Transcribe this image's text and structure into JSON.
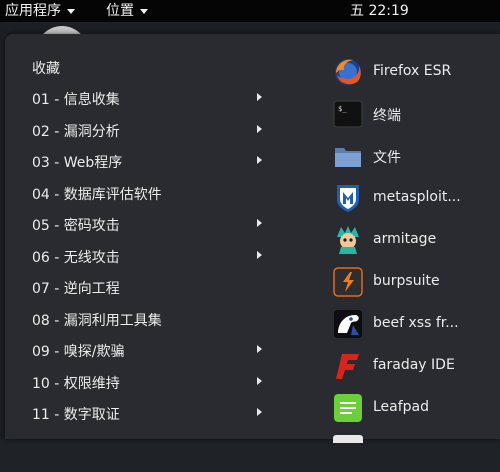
{
  "topbar": {
    "applications_label": "应用程序",
    "places_label": "位置",
    "clock": "五 22:19"
  },
  "menu": {
    "categories": [
      {
        "label": "收藏"
      },
      {
        "label": "01 - 信息收集"
      },
      {
        "label": "02 - 漏洞分析"
      },
      {
        "label": "03 - Web程序"
      },
      {
        "label": "04 - 数据库评估软件"
      },
      {
        "label": "05 - 密码攻击"
      },
      {
        "label": "06 - 无线攻击"
      },
      {
        "label": "07 - 逆向工程"
      },
      {
        "label": "08 - 漏洞利用工具集"
      },
      {
        "label": "09 - 嗅探/欺骗"
      },
      {
        "label": "10 - 权限维持"
      },
      {
        "label": "11 - 数字取证"
      }
    ],
    "favorites": [
      {
        "label": "Firefox ESR",
        "icon": "firefox-icon"
      },
      {
        "label": "终端",
        "icon": "terminal-icon"
      },
      {
        "label": "文件",
        "icon": "folder-icon"
      },
      {
        "label": "metasploit...",
        "icon": "metasploit-icon"
      },
      {
        "label": "armitage",
        "icon": "armitage-icon"
      },
      {
        "label": "burpsuite",
        "icon": "burpsuite-icon"
      },
      {
        "label": "beef xss fr...",
        "icon": "beef-icon"
      },
      {
        "label": "faraday IDE",
        "icon": "faraday-icon"
      },
      {
        "label": "Leafpad",
        "icon": "leafpad-icon"
      }
    ]
  }
}
